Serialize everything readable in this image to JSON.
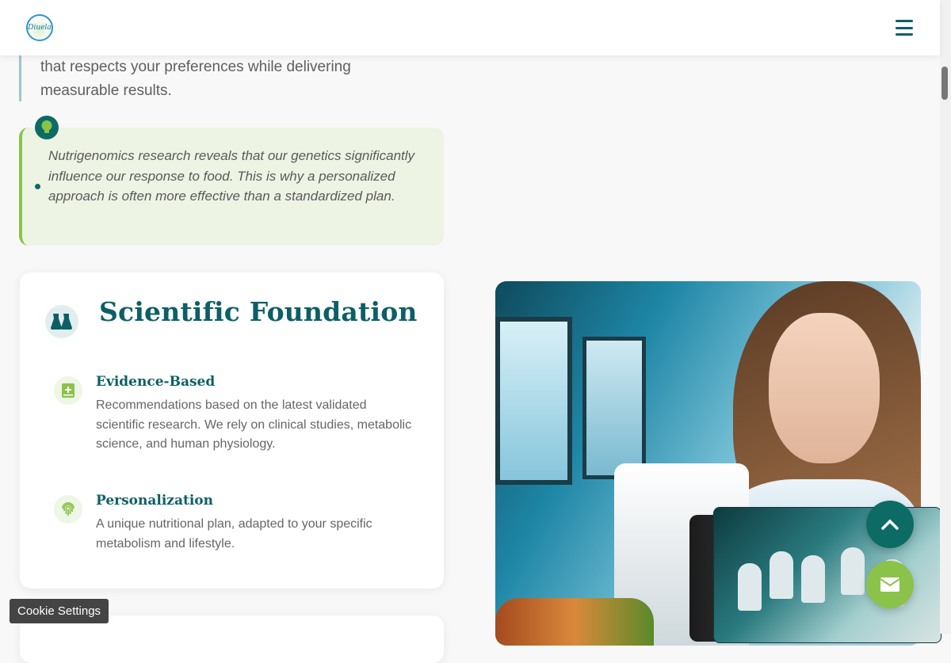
{
  "header": {
    "logo_text": "Diuela",
    "menu_icon": "hamburger-icon"
  },
  "intro": {
    "quote_text": "that respects your preferences while delivering measurable results."
  },
  "tip": {
    "icon": "lightbulb-icon",
    "text": "Nutrigenomics research reveals that our genetics significantly influence our response to food. This is why a personalized approach is often more effective than a standardized plan."
  },
  "scientific_card": {
    "icon": "flask-icon",
    "title": "Scientific Foundation",
    "features": [
      {
        "icon": "book-plus-icon",
        "title": "Evidence-Based",
        "description": "Recommendations based on the latest validated scientific research. We rely on clinical studies, metabolic science, and human physiology."
      },
      {
        "icon": "fingerprint-icon",
        "title": "Personalization",
        "description": "A unique nutritional plan, adapted to your specific metabolism and lifestyle."
      }
    ]
  },
  "floating": {
    "scroll_top_icon": "chevron-up-icon",
    "contact_icon": "envelope-icon"
  },
  "cookie": {
    "label": "Cookie Settings"
  },
  "colors": {
    "primary": "#0d5f66",
    "accent": "#8bc34a",
    "tip_bg": "#edf4e4"
  }
}
